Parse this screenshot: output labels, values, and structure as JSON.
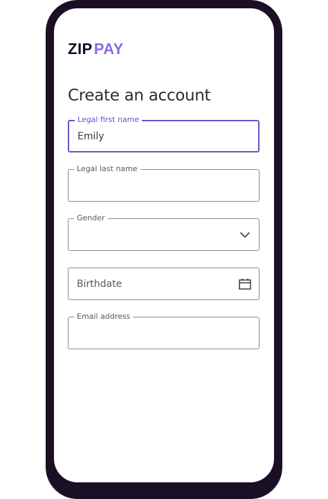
{
  "brand": {
    "logo_zip": "ZIP",
    "logo_pay": "PAY",
    "colors": {
      "dark": "#1a0826",
      "accent": "#8b6ae8",
      "focus": "#6a4fc7",
      "frame": "#1b0f26"
    }
  },
  "page": {
    "title": "Create an account"
  },
  "form": {
    "first_name": {
      "label": "Legal first name",
      "value": "Emily",
      "focused": true
    },
    "last_name": {
      "label": "Legal last name",
      "value": ""
    },
    "gender": {
      "label": "Gender",
      "value": "",
      "icon": "chevron-down-icon"
    },
    "birthdate": {
      "placeholder": "Birthdate",
      "icon": "calendar-icon"
    },
    "email": {
      "label": "Email address",
      "value": ""
    }
  }
}
